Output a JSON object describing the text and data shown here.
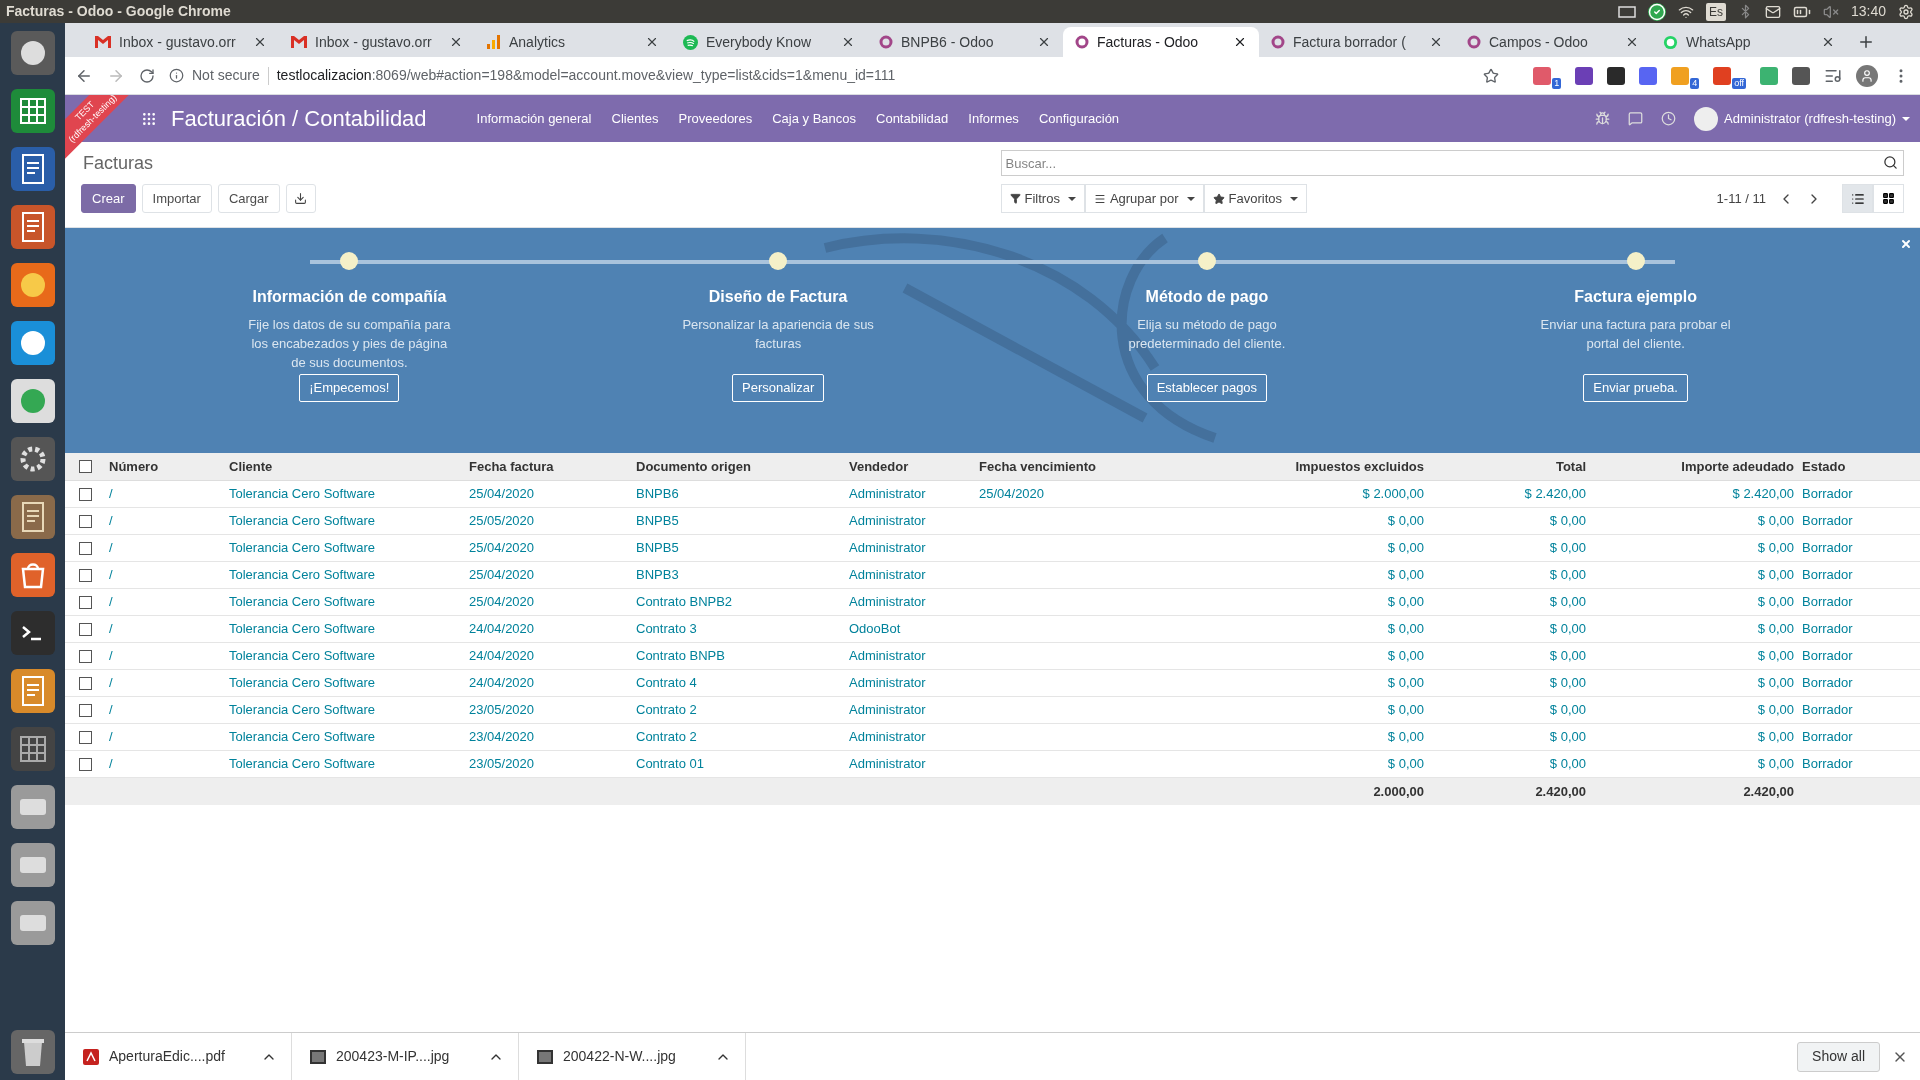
{
  "system_bar": {
    "title": "Facturas - Odoo - Google Chrome",
    "keyboard": "Es",
    "time": "13:40"
  },
  "tabs": [
    {
      "label": "Inbox - gustavo.orr",
      "kind": "mail",
      "selected": false
    },
    {
      "label": "Inbox - gustavo.orr",
      "kind": "mail",
      "selected": false
    },
    {
      "label": "Analytics",
      "kind": "analytics",
      "selected": false
    },
    {
      "label": "Everybody Know",
      "kind": "music",
      "selected": false
    },
    {
      "label": "BNPB6 - Odoo",
      "kind": "odoo",
      "selected": false
    },
    {
      "label": "Facturas - Odoo",
      "kind": "odoo",
      "selected": true
    },
    {
      "label": "Factura borrador (",
      "kind": "odoo",
      "selected": false
    },
    {
      "label": "Campos - Odoo",
      "kind": "odoo",
      "selected": false
    },
    {
      "label": "WhatsApp",
      "kind": "chat",
      "selected": false
    }
  ],
  "address_bar": {
    "security": "Not secure",
    "host": "testlocalizacion",
    "path": ":8069/web#action=198&model=account.move&view_type=list&cids=1&menu_id=111"
  },
  "extensions": [
    {
      "color": "#e05a6a",
      "badge": "1"
    },
    {
      "color": "#6b3fb5"
    },
    {
      "color": "#2a2a2a"
    },
    {
      "color": "#5865f2"
    },
    {
      "color": "#f0a020",
      "badge": "4"
    },
    {
      "color": "#e04020",
      "badge": "off"
    },
    {
      "color": "#3cb371"
    },
    {
      "color": "#555555"
    }
  ],
  "navbar": {
    "app": "Facturación / Contabilidad",
    "menu": [
      "Información general",
      "Clientes",
      "Proveedores",
      "Caja y Bancos",
      "Contabilidad",
      "Informes",
      "Configuración"
    ],
    "user": "Administrator (rdfresh-testing)"
  },
  "ribbon": {
    "label": "TEST",
    "database": "(rdfresh-testing)"
  },
  "control_panel": {
    "breadcrumb": "Facturas",
    "buttons": [
      "Crear",
      "Importar",
      "Cargar"
    ],
    "search": {
      "placeholder": "Buscar..."
    },
    "filters": [
      "Filtros",
      "Agrupar por",
      "Favoritos"
    ],
    "pager": "1-11 / 11",
    "views": [
      {
        "kind": "list",
        "selected": true
      },
      {
        "kind": "kanban",
        "selected": false
      }
    ]
  },
  "onboarding": {
    "steps": [
      {
        "title": "Información de compañía",
        "description": "Fije los datos de su compañía para los encabezados y pies de página de sus documentos.",
        "button": "¡Empecemos!"
      },
      {
        "title": "Diseño de Factura",
        "description": "Personalizar la apariencia de sus facturas",
        "button": "Personalizar"
      },
      {
        "title": "Método de pago",
        "description": "Elija su método de pago predeterminado del cliente.",
        "button": "Establecer pagos"
      },
      {
        "title": "Factura ejemplo",
        "description": "Enviar una factura para probar el portal del cliente.",
        "button": "Enviar prueba."
      }
    ]
  },
  "table": {
    "select_all_checked": false,
    "columns": [
      "Número",
      "Cliente",
      "Fecha factura",
      "Documento origen",
      "Vendedor",
      "Fecha vencimiento",
      "Impuestos excluidos",
      "Total",
      "Importe adeudado",
      "Estado"
    ],
    "rows": [
      {
        "checked": false,
        "cells": [
          "/",
          "Tolerancia Cero Software",
          "25/04/2020",
          "BNPB6",
          "Administrator",
          "25/04/2020",
          "$ 2.000,00",
          "$ 2.420,00",
          "$ 2.420,00",
          "Borrador"
        ]
      },
      {
        "checked": false,
        "cells": [
          "/",
          "Tolerancia Cero Software",
          "25/05/2020",
          "BNPB5",
          "Administrator",
          "",
          "$ 0,00",
          "$ 0,00",
          "$ 0,00",
          "Borrador"
        ]
      },
      {
        "checked": false,
        "cells": [
          "/",
          "Tolerancia Cero Software",
          "25/04/2020",
          "BNPB5",
          "Administrator",
          "",
          "$ 0,00",
          "$ 0,00",
          "$ 0,00",
          "Borrador"
        ]
      },
      {
        "checked": false,
        "cells": [
          "/",
          "Tolerancia Cero Software",
          "25/04/2020",
          "BNPB3",
          "Administrator",
          "",
          "$ 0,00",
          "$ 0,00",
          "$ 0,00",
          "Borrador"
        ]
      },
      {
        "checked": false,
        "cells": [
          "/",
          "Tolerancia Cero Software",
          "25/04/2020",
          "Contrato BNPB2",
          "Administrator",
          "",
          "$ 0,00",
          "$ 0,00",
          "$ 0,00",
          "Borrador"
        ]
      },
      {
        "checked": false,
        "cells": [
          "/",
          "Tolerancia Cero Software",
          "24/04/2020",
          "Contrato 3",
          "OdooBot",
          "",
          "$ 0,00",
          "$ 0,00",
          "$ 0,00",
          "Borrador"
        ]
      },
      {
        "checked": false,
        "cells": [
          "/",
          "Tolerancia Cero Software",
          "24/04/2020",
          "Contrato BNPB",
          "Administrator",
          "",
          "$ 0,00",
          "$ 0,00",
          "$ 0,00",
          "Borrador"
        ]
      },
      {
        "checked": false,
        "cells": [
          "/",
          "Tolerancia Cero Software",
          "24/04/2020",
          "Contrato 4",
          "Administrator",
          "",
          "$ 0,00",
          "$ 0,00",
          "$ 0,00",
          "Borrador"
        ]
      },
      {
        "checked": false,
        "cells": [
          "/",
          "Tolerancia Cero Software",
          "23/05/2020",
          "Contrato 2",
          "Administrator",
          "",
          "$ 0,00",
          "$ 0,00",
          "$ 0,00",
          "Borrador"
        ]
      },
      {
        "checked": false,
        "cells": [
          "/",
          "Tolerancia Cero Software",
          "23/04/2020",
          "Contrato 2",
          "Administrator",
          "",
          "$ 0,00",
          "$ 0,00",
          "$ 0,00",
          "Borrador"
        ]
      },
      {
        "checked": false,
        "cells": [
          "/",
          "Tolerancia Cero Software",
          "23/05/2020",
          "Contrato 01",
          "Administrator",
          "",
          "$ 0,00",
          "$ 0,00",
          "$ 0,00",
          "Borrador"
        ]
      }
    ],
    "totals": [
      "2.000,00",
      "2.420,00",
      "2.420,00"
    ]
  },
  "downloads": {
    "items": [
      {
        "name": "AperturaEdic....pdf",
        "kind": "pdf"
      },
      {
        "name": "200423-M-IP....jpg",
        "kind": "image"
      },
      {
        "name": "200422-N-W....jpg",
        "kind": "image"
      }
    ],
    "show_all": "Show all"
  }
}
